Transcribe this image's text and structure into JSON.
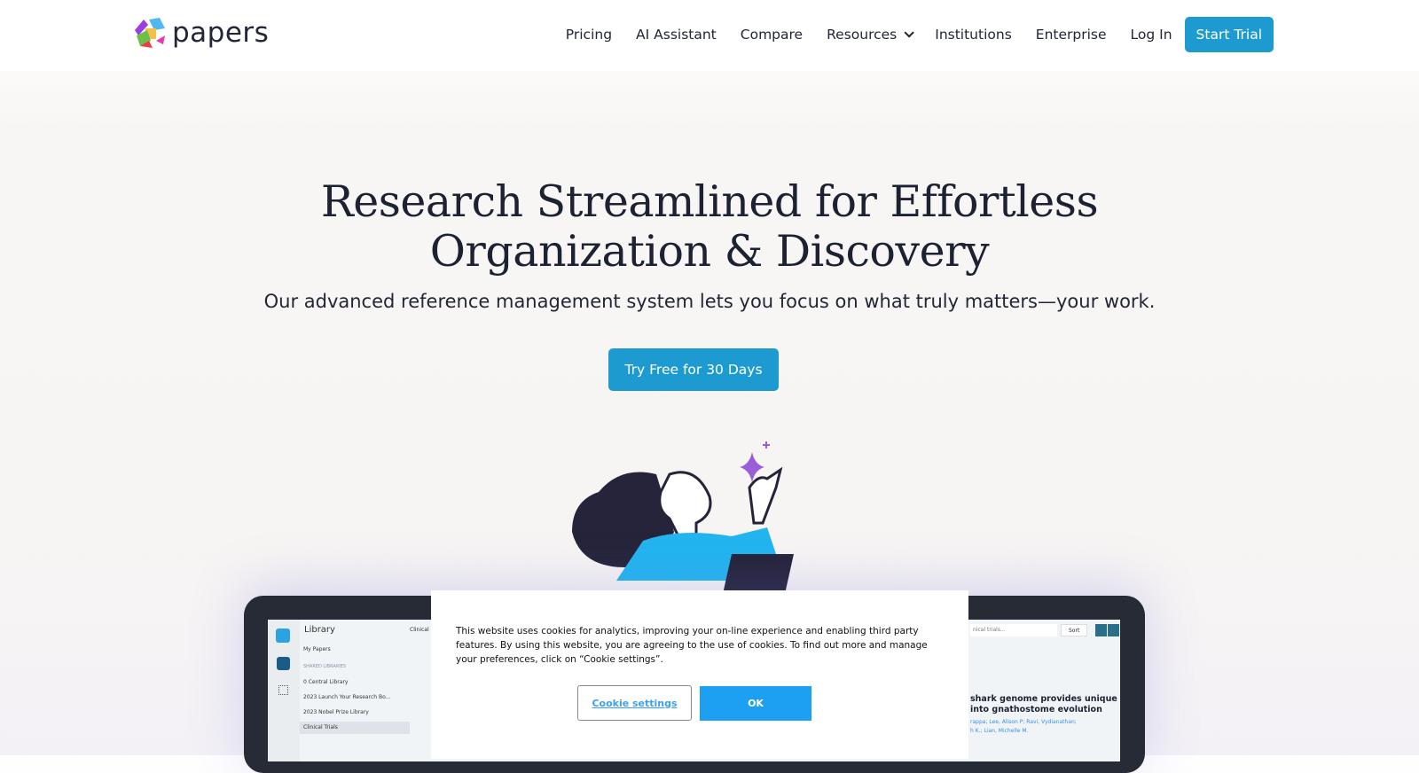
{
  "brand": {
    "name": "papers"
  },
  "nav": {
    "items": [
      "Pricing",
      "AI Assistant",
      "Compare",
      "Resources",
      "Institutions",
      "Enterprise",
      "Log In"
    ],
    "cta": "Start Trial"
  },
  "hero": {
    "title_line1": "Research Streamlined for Effortless",
    "title_line2": "Organization & Discovery",
    "subtitle": "Our advanced reference management system lets you focus on what truly matters—your work.",
    "cta": "Try Free for 30 Days"
  },
  "app": {
    "library_title": "Library",
    "my_papers": "My Papers",
    "shared_header": "SHARED LIBRARIES",
    "libraries": [
      "0 Central Library",
      "2023 Launch Your Research Bo...",
      "2023 Nobel Prize Library",
      "Clinical Trials"
    ],
    "column_header": "Clinical",
    "search_placeholder": "nical trials...",
    "sort": "Sort",
    "paper_title_1": "shark genome provides unique",
    "paper_title_2": "into gnathostome evolution",
    "authors_1": "rappa; Lee, Alison P; Ravi, Vydianathan;",
    "authors_2": "h K.; Lian, Michelle M."
  },
  "cookie": {
    "text": "This website uses cookies for analytics, improving your on-line experience and enabling third party features. By using this website, you are agreeing to the use of cookies. To find out more and manage your preferences, click on “Cookie settings”.",
    "settings": "Cookie settings",
    "ok": "OK"
  },
  "colors": {
    "accent": "#1d9bd1",
    "ok": "#1ea0f2"
  }
}
